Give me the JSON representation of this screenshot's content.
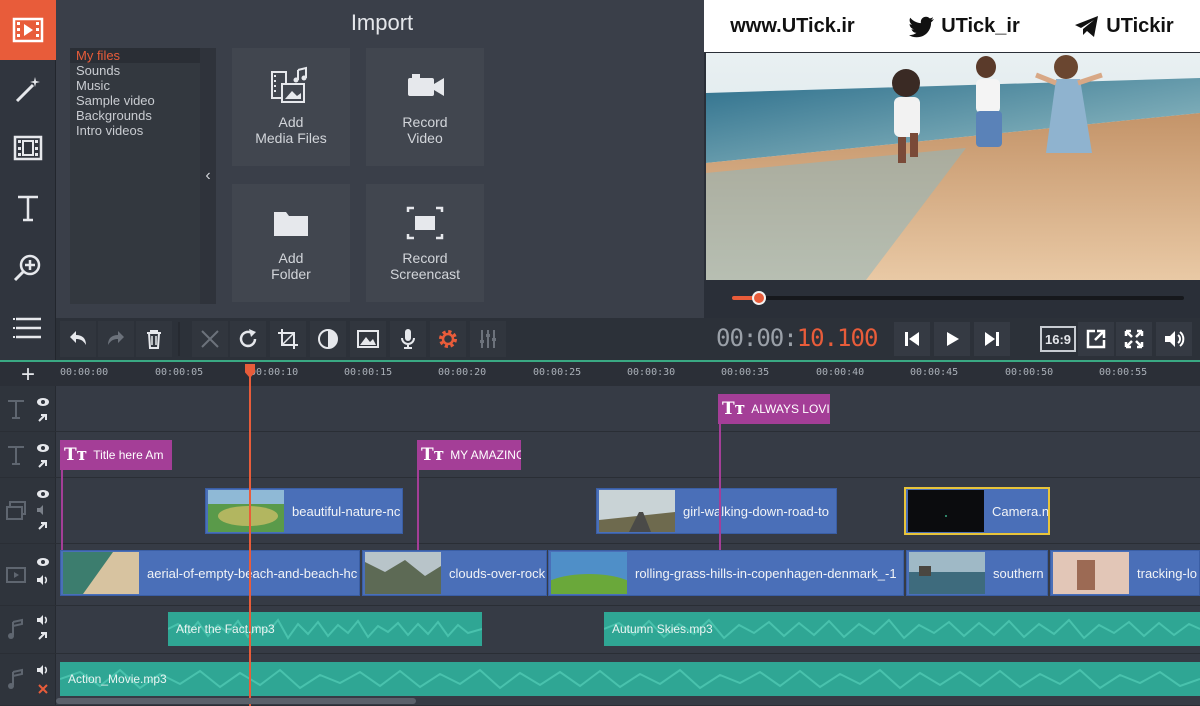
{
  "import_panel": {
    "title": "Import",
    "categories": [
      "My files",
      "Sounds",
      "Music",
      "Sample video",
      "Backgrounds",
      "Intro videos"
    ],
    "selected_category": "My files",
    "tiles": [
      {
        "label": "Add\nMedia Files",
        "icon": "media-files-icon"
      },
      {
        "label": "Record\nVideo",
        "icon": "video-camera-icon"
      },
      {
        "label": "Add\nFolder",
        "icon": "folder-icon"
      },
      {
        "label": "Record\nScreencast",
        "icon": "screencast-icon"
      }
    ]
  },
  "watermark": {
    "site": "www.UTick.ir",
    "twitter": "UTick_ir",
    "telegram": "UTickir"
  },
  "player": {
    "timecode_dim": "00:00:",
    "timecode_active": "10.100",
    "aspect_ratio": "16:9",
    "progress": 0.06
  },
  "timeline": {
    "ticks": [
      "00:00:00",
      "00:00:05",
      "00:00:10",
      "00:00:15",
      "00:00:20",
      "00:00:25",
      "00:00:30",
      "00:00:35",
      "00:00:40",
      "00:00:45",
      "00:00:50",
      "00:00:55"
    ],
    "title_track_1": [
      {
        "text": "ALWAYS LOVI"
      }
    ],
    "title_track_2": [
      {
        "text": "Title here Am"
      },
      {
        "text": "MY AMAZING"
      }
    ],
    "overlay_track": [
      {
        "name": "beautiful-nature-nc"
      },
      {
        "name": "girl-walking-down-road-to"
      },
      {
        "name": "Camera.n"
      }
    ],
    "video_track": [
      {
        "name": "aerial-of-empty-beach-and-beach-hc"
      },
      {
        "name": "clouds-over-rock"
      },
      {
        "name": "rolling-grass-hills-in-copenhagen-denmark_-1"
      },
      {
        "name": "southern"
      },
      {
        "name": "tracking-lo"
      }
    ],
    "audio_track_1": [
      {
        "name": "After the Fact.mp3"
      },
      {
        "name": "Autumn Skies.mp3"
      }
    ],
    "audio_track_2": [
      {
        "name": "Action_Movie.mp3"
      }
    ]
  },
  "colors": {
    "accent": "#e85c3a",
    "title_clip": "#a43e97",
    "video_clip": "#4a6fb8",
    "audio_clip": "#2fa694"
  }
}
